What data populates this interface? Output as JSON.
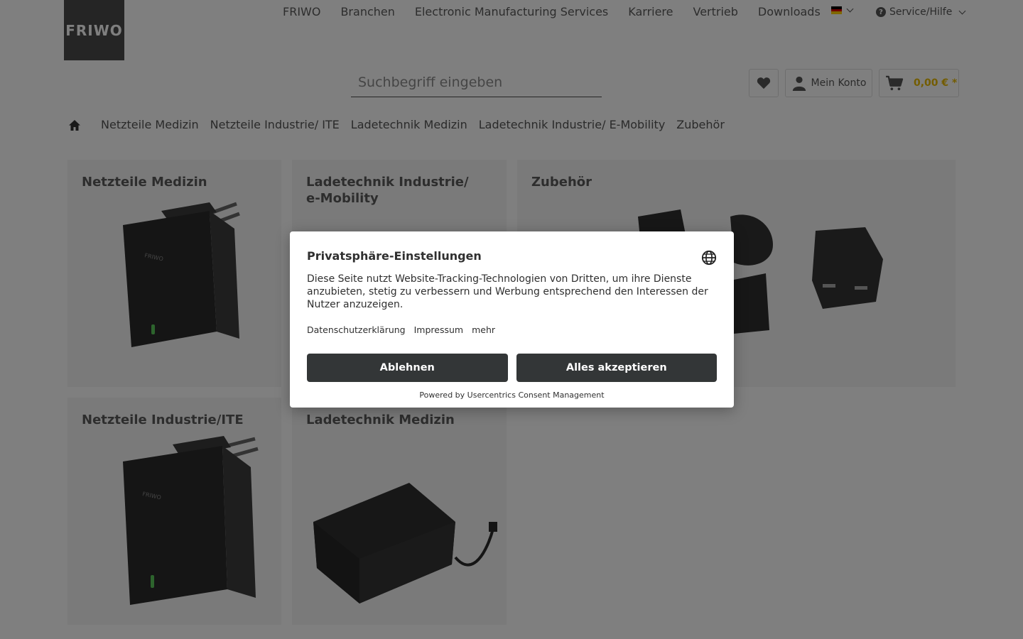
{
  "header": {
    "logo_text": "FRIWO",
    "nav": [
      "FRIWO",
      "Branchen",
      "Electronic Manufacturing Services",
      "Karriere",
      "Vertrieb",
      "Downloads"
    ],
    "service_label": "Service/Hilfe",
    "search_placeholder": "Suchbegriff eingeben",
    "account_label": "Mein Konto",
    "cart_price": "0,00 € *",
    "accent_color": "#e6b800"
  },
  "breadcrumb": [
    "Netzteile Medizin",
    "Netzteile Industrie/ ITE",
    "Ladetechnik Medizin",
    "Ladetechnik Industrie/ E-Mobility",
    "Zubehör"
  ],
  "tiles": {
    "netzteile_medizin": "Netzteile Medizin",
    "ladetechnik_industrie": "Ladetechnik Industrie/ e-Mobility",
    "zubehoer": "Zubehör",
    "netzteile_industrie": "Netzteile Industrie/ITE",
    "ladetechnik_medizin": "Ladetechnik Medizin",
    "product_brand": "FRIWO"
  },
  "consent": {
    "title": "Privatsphäre-Einstellungen",
    "text": "Diese Seite nutzt Website-Tracking-Technologien von Dritten, um ihre Dienste anzubieten, stetig zu verbessern und Werbung entsprechend den Interessen der Nutzer anzuzeigen.",
    "links": [
      "Datenschutzerklärung",
      "Impressum",
      "mehr"
    ],
    "decline_label": "Ablehnen",
    "accept_label": "Alles akzeptieren",
    "powered_by": "Powered by Usercentrics Consent Management"
  }
}
